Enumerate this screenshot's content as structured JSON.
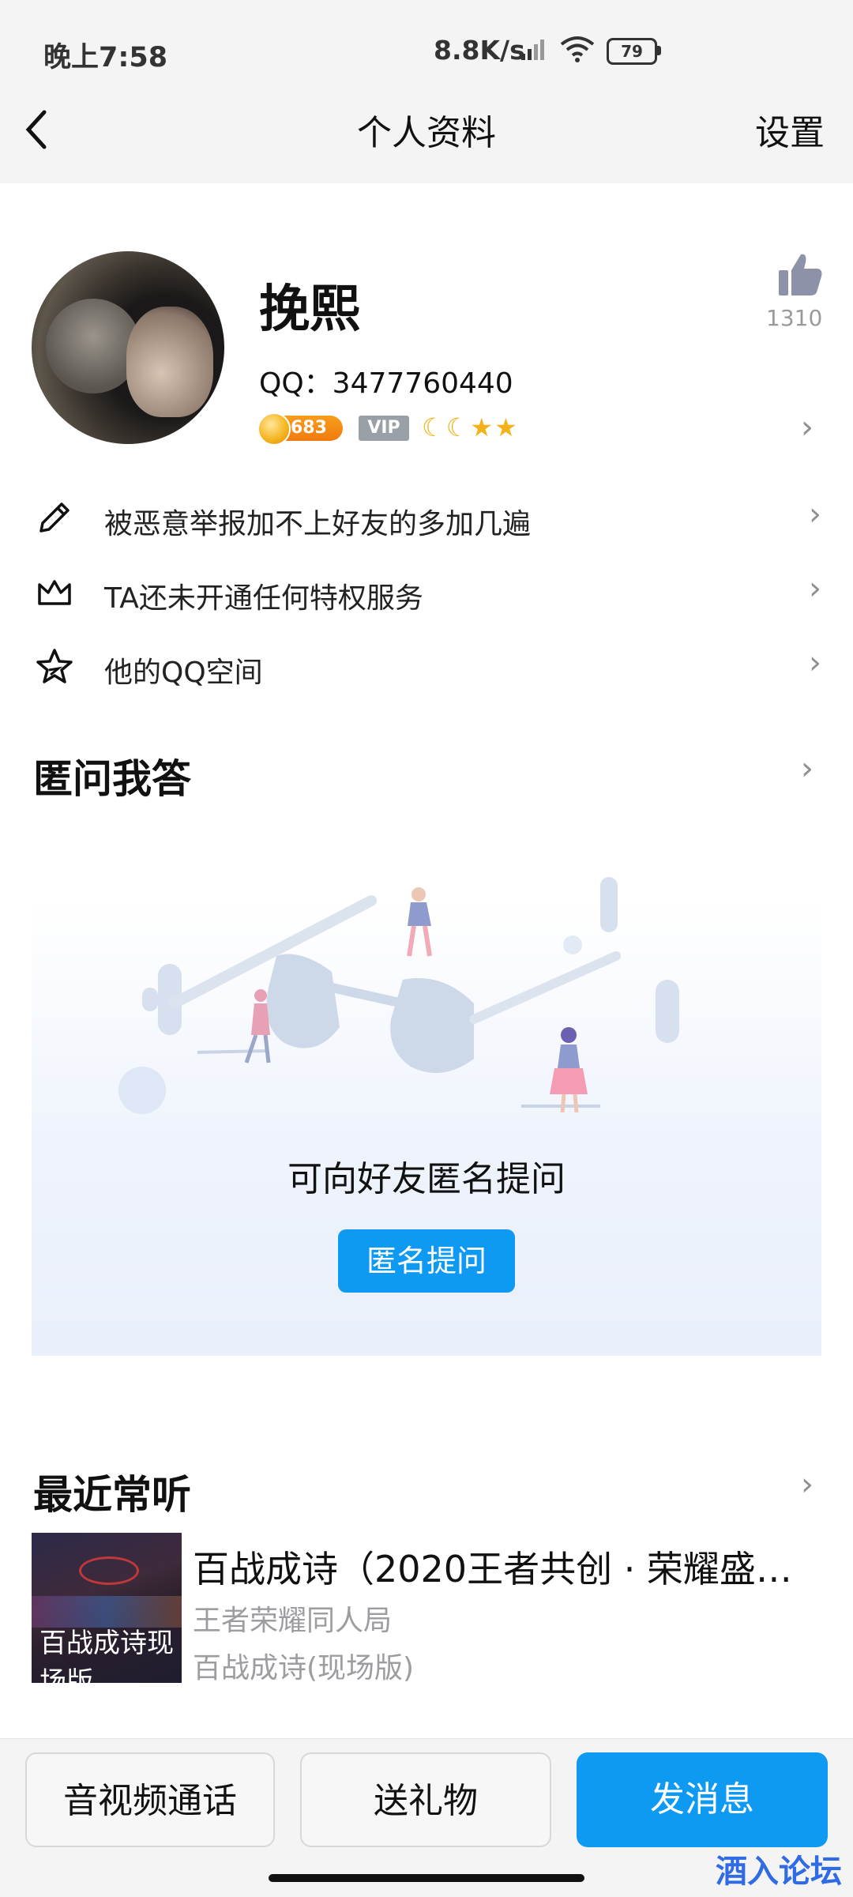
{
  "status_bar": {
    "time": "晚上7:58",
    "net_speed": "8.8K/s",
    "battery": "79"
  },
  "header": {
    "title": "个人资料",
    "right_action": "设置"
  },
  "profile": {
    "name": "挽熙",
    "qq": "QQ：3477760440",
    "level": "683",
    "vip": "VIP",
    "likes": "1310"
  },
  "info_rows": [
    {
      "label": "被恶意举报加不上好友的多加几遍",
      "icon": "pencil-icon"
    },
    {
      "label": "TA还未开通任何特权服务",
      "icon": "crown-icon"
    },
    {
      "label": "他的QQ空间",
      "icon": "star-icon"
    }
  ],
  "anon_section": {
    "title": "匿问我答",
    "prompt": "可向好友匿名提问",
    "button": "匿名提问"
  },
  "music_section": {
    "title": "最近常听",
    "song_title": "百战成诗（2020王者共创 · 荣耀盛…",
    "artist": "王者荣耀同人局",
    "album": "百战成诗(现场版)",
    "album_art_text": "百战成诗现场版"
  },
  "bottom_bar": {
    "call": "音视频通话",
    "gift": "送礼物",
    "message": "发消息"
  },
  "watermark": "酒入论坛",
  "colors": {
    "accent": "#0e99f2",
    "gray_text": "#9c9ca1"
  }
}
